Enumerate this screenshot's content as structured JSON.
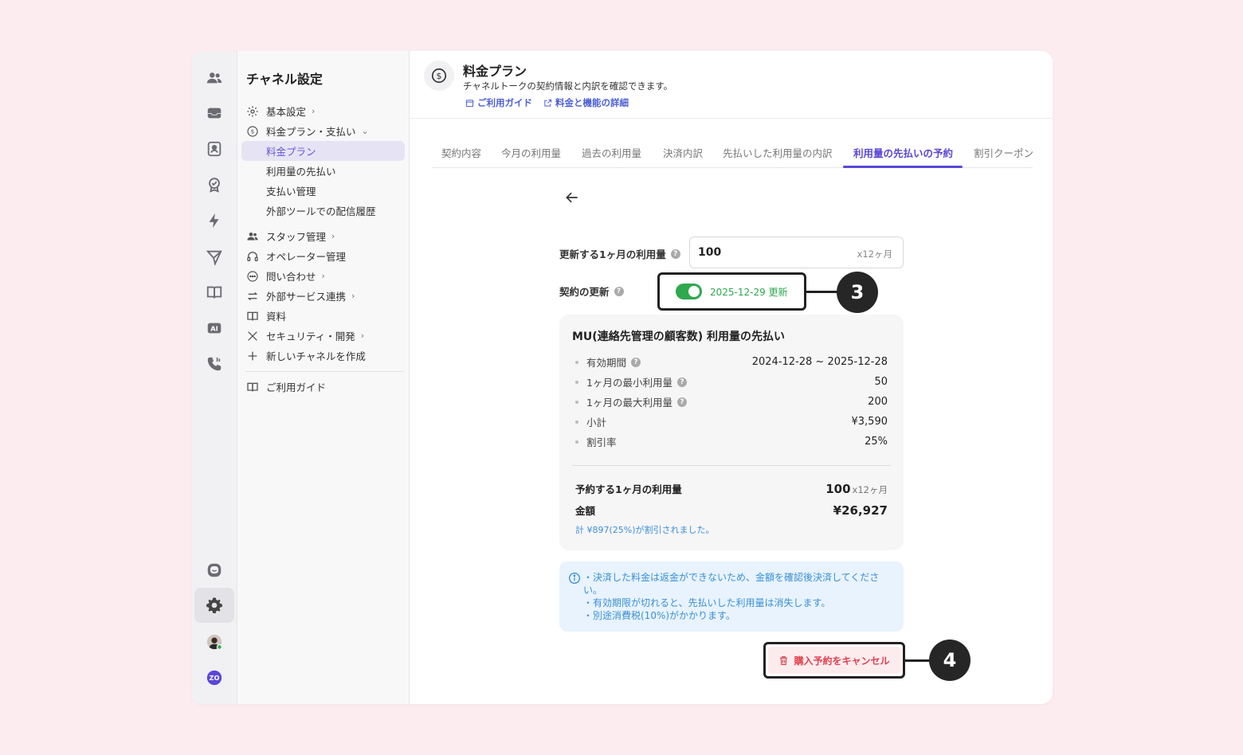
{
  "sidebar": {
    "title": "チャネル設定",
    "items": [
      {
        "label": "基本設定",
        "chevron": "›"
      },
      {
        "label": "料金プラン・支払い",
        "chevron": "⌄"
      },
      {
        "label": "料金プラン"
      },
      {
        "label": "利用量の先払い"
      },
      {
        "label": "支払い管理"
      },
      {
        "label": "外部ツールでの配信履歴"
      },
      {
        "label": "スタッフ管理",
        "chevron": "›"
      },
      {
        "label": "オペレーター管理"
      },
      {
        "label": "問い合わせ",
        "chevron": "›"
      },
      {
        "label": "外部サービス連携",
        "chevron": "›"
      },
      {
        "label": "資料"
      },
      {
        "label": "セキュリティ・開発",
        "chevron": "›"
      },
      {
        "label": "新しいチャネルを作成"
      },
      {
        "label": "ご利用ガイド"
      }
    ]
  },
  "header": {
    "title": "料金プラン",
    "description": "チャネルトークの契約情報と内訳を確認できます。",
    "links": [
      "ご利用ガイド",
      "料金と機能の詳細"
    ]
  },
  "tabs": [
    "契約内容",
    "今月の利用量",
    "過去の利用量",
    "決済内訳",
    "先払いした利用量の内訳",
    "利用量の先払いの予約",
    "割引クーポン"
  ],
  "form": {
    "usage_label": "更新する1ヶ月の利用量",
    "usage_value": "100",
    "usage_suffix": "x12ヶ月",
    "renewal_label": "契約の更新",
    "renewal_text": "2025-12-29 更新",
    "renewal_on": true
  },
  "summary": {
    "title": "MU(連絡先管理の顧客数) 利用量の先払い",
    "rows": [
      {
        "label": "有効期間",
        "value": "2024-12-28 ~ 2025-12-28"
      },
      {
        "label": "1ヶ月の最小利用量",
        "value": "50"
      },
      {
        "label": "1ヶ月の最大利用量",
        "value": "200"
      },
      {
        "label": "小計",
        "value": "¥3,590"
      },
      {
        "label": "割引率",
        "value": "25%"
      }
    ],
    "reserve_label": "予約する1ヶ月の利用量",
    "reserve_value": "100",
    "reserve_unit": "x12ヶ月",
    "amount_label": "金額",
    "amount_value": "¥26,927",
    "discount_note": "計 ¥897(25%)が割引されました。"
  },
  "notice": [
    "・決済した料金は返金ができないため、金額を確認後決済してください。",
    "・有効期限が切れると、先払いした利用量は消失します。",
    "・別途消費税(10%)がかかります。"
  ],
  "cancel_button": "購入予約をキャンセル",
  "callouts": [
    "3",
    "4"
  ],
  "colors": {
    "accent": "#5a48d6",
    "link": "#4c5fd5",
    "toggle": "#2fa84f",
    "danger": "#e0414f",
    "info": "#3a8fd6"
  },
  "icons": {
    "back": "arrow-left-icon",
    "cancel": "trash-icon",
    "info": "info-icon"
  }
}
